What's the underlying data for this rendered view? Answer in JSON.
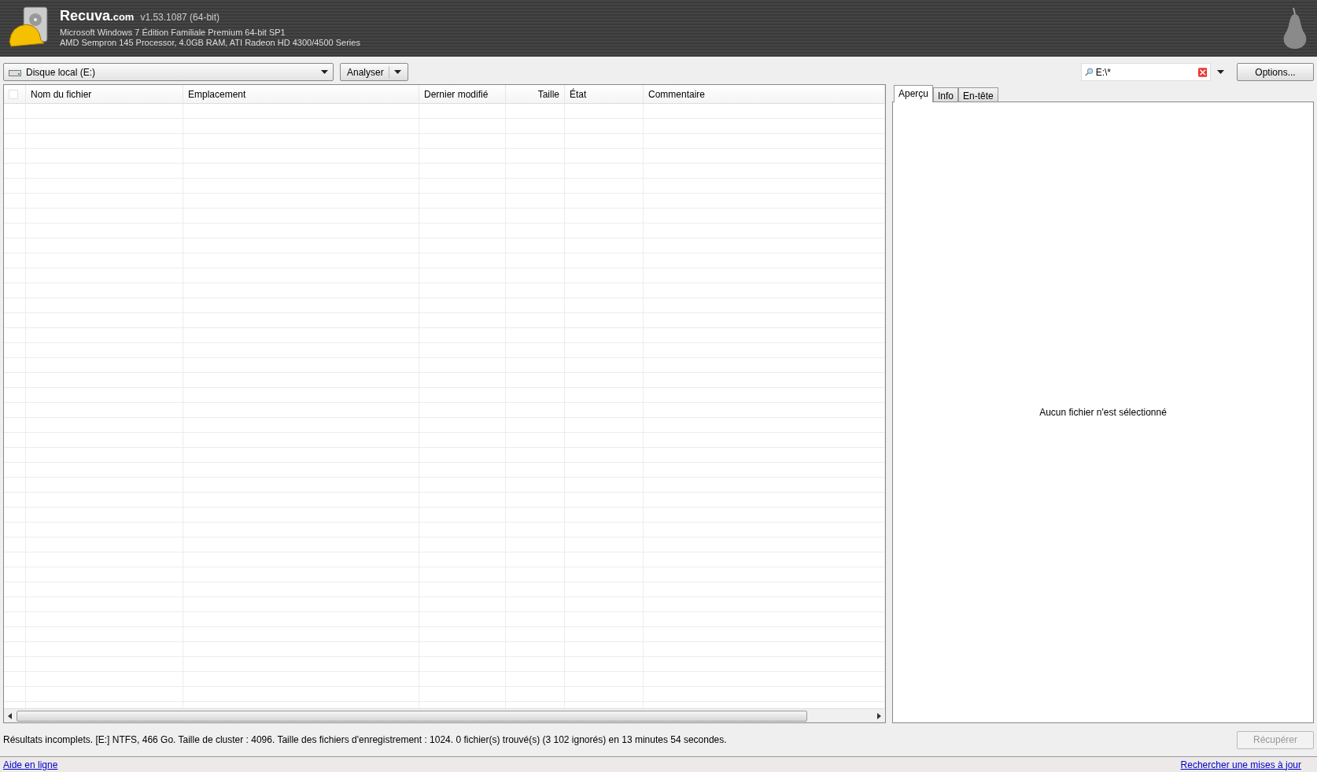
{
  "app": {
    "brand": "Recuva",
    "brand_suffix": ".com",
    "version": "v1.53.1087 (64-bit)",
    "system_lines": [
      "Microsoft Windows 7 Édition Familiale Premium 64-bit SP1",
      "AMD Sempron 145 Processor, 4.0GB RAM, ATI Radeon HD 4300/4500 Series"
    ]
  },
  "toolbar": {
    "drive": "Disque local (E:)",
    "scan_button": "Analyser",
    "filter": {
      "value": "E:\\*"
    },
    "options_button": "Options..."
  },
  "table": {
    "select_all_checked": false,
    "columns": [
      {
        "label": "Nom du fichier",
        "kind": "text"
      },
      {
        "label": "Emplacement",
        "kind": "text"
      },
      {
        "label": "Dernier modifié",
        "kind": "text"
      },
      {
        "label": "Taille",
        "kind": "number"
      },
      {
        "label": "État",
        "kind": "text"
      },
      {
        "label": "Commentaire",
        "kind": "text"
      }
    ]
  },
  "preview": {
    "tabs": [
      {
        "label": "Aperçu",
        "selected": true
      },
      {
        "label": "Info",
        "selected": false
      },
      {
        "label": "En-tête",
        "selected": false
      }
    ],
    "message": "Aucun fichier n'est sélectionné"
  },
  "status": {
    "text": "Résultats incomplets. [E:] NTFS, 466 Go. Taille de cluster : 4096. Taille des fichiers d'enregistrement : 1024. 0 fichier(s) trouvé(s) (3 102 ignorés) en 13 minutes 54 secondes.",
    "recover_button": {
      "label": "Récupérer",
      "disabled": true
    }
  },
  "footer": {
    "links": [
      "Aide en ligne",
      "Rechercher une mises à jour"
    ]
  }
}
